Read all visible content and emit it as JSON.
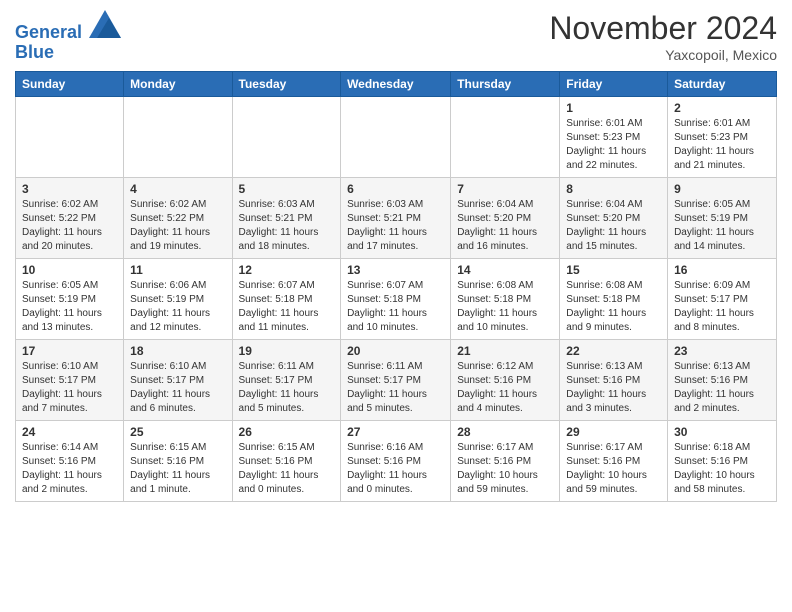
{
  "logo": {
    "line1": "General",
    "line2": "Blue"
  },
  "header": {
    "month": "November 2024",
    "location": "Yaxcopoil, Mexico"
  },
  "weekdays": [
    "Sunday",
    "Monday",
    "Tuesday",
    "Wednesday",
    "Thursday",
    "Friday",
    "Saturday"
  ],
  "weeks": [
    [
      {
        "day": "",
        "info": ""
      },
      {
        "day": "",
        "info": ""
      },
      {
        "day": "",
        "info": ""
      },
      {
        "day": "",
        "info": ""
      },
      {
        "day": "",
        "info": ""
      },
      {
        "day": "1",
        "info": "Sunrise: 6:01 AM\nSunset: 5:23 PM\nDaylight: 11 hours and 22 minutes."
      },
      {
        "day": "2",
        "info": "Sunrise: 6:01 AM\nSunset: 5:23 PM\nDaylight: 11 hours and 21 minutes."
      }
    ],
    [
      {
        "day": "3",
        "info": "Sunrise: 6:02 AM\nSunset: 5:22 PM\nDaylight: 11 hours and 20 minutes."
      },
      {
        "day": "4",
        "info": "Sunrise: 6:02 AM\nSunset: 5:22 PM\nDaylight: 11 hours and 19 minutes."
      },
      {
        "day": "5",
        "info": "Sunrise: 6:03 AM\nSunset: 5:21 PM\nDaylight: 11 hours and 18 minutes."
      },
      {
        "day": "6",
        "info": "Sunrise: 6:03 AM\nSunset: 5:21 PM\nDaylight: 11 hours and 17 minutes."
      },
      {
        "day": "7",
        "info": "Sunrise: 6:04 AM\nSunset: 5:20 PM\nDaylight: 11 hours and 16 minutes."
      },
      {
        "day": "8",
        "info": "Sunrise: 6:04 AM\nSunset: 5:20 PM\nDaylight: 11 hours and 15 minutes."
      },
      {
        "day": "9",
        "info": "Sunrise: 6:05 AM\nSunset: 5:19 PM\nDaylight: 11 hours and 14 minutes."
      }
    ],
    [
      {
        "day": "10",
        "info": "Sunrise: 6:05 AM\nSunset: 5:19 PM\nDaylight: 11 hours and 13 minutes."
      },
      {
        "day": "11",
        "info": "Sunrise: 6:06 AM\nSunset: 5:19 PM\nDaylight: 11 hours and 12 minutes."
      },
      {
        "day": "12",
        "info": "Sunrise: 6:07 AM\nSunset: 5:18 PM\nDaylight: 11 hours and 11 minutes."
      },
      {
        "day": "13",
        "info": "Sunrise: 6:07 AM\nSunset: 5:18 PM\nDaylight: 11 hours and 10 minutes."
      },
      {
        "day": "14",
        "info": "Sunrise: 6:08 AM\nSunset: 5:18 PM\nDaylight: 11 hours and 10 minutes."
      },
      {
        "day": "15",
        "info": "Sunrise: 6:08 AM\nSunset: 5:18 PM\nDaylight: 11 hours and 9 minutes."
      },
      {
        "day": "16",
        "info": "Sunrise: 6:09 AM\nSunset: 5:17 PM\nDaylight: 11 hours and 8 minutes."
      }
    ],
    [
      {
        "day": "17",
        "info": "Sunrise: 6:10 AM\nSunset: 5:17 PM\nDaylight: 11 hours and 7 minutes."
      },
      {
        "day": "18",
        "info": "Sunrise: 6:10 AM\nSunset: 5:17 PM\nDaylight: 11 hours and 6 minutes."
      },
      {
        "day": "19",
        "info": "Sunrise: 6:11 AM\nSunset: 5:17 PM\nDaylight: 11 hours and 5 minutes."
      },
      {
        "day": "20",
        "info": "Sunrise: 6:11 AM\nSunset: 5:17 PM\nDaylight: 11 hours and 5 minutes."
      },
      {
        "day": "21",
        "info": "Sunrise: 6:12 AM\nSunset: 5:16 PM\nDaylight: 11 hours and 4 minutes."
      },
      {
        "day": "22",
        "info": "Sunrise: 6:13 AM\nSunset: 5:16 PM\nDaylight: 11 hours and 3 minutes."
      },
      {
        "day": "23",
        "info": "Sunrise: 6:13 AM\nSunset: 5:16 PM\nDaylight: 11 hours and 2 minutes."
      }
    ],
    [
      {
        "day": "24",
        "info": "Sunrise: 6:14 AM\nSunset: 5:16 PM\nDaylight: 11 hours and 2 minutes."
      },
      {
        "day": "25",
        "info": "Sunrise: 6:15 AM\nSunset: 5:16 PM\nDaylight: 11 hours and 1 minute."
      },
      {
        "day": "26",
        "info": "Sunrise: 6:15 AM\nSunset: 5:16 PM\nDaylight: 11 hours and 0 minutes."
      },
      {
        "day": "27",
        "info": "Sunrise: 6:16 AM\nSunset: 5:16 PM\nDaylight: 11 hours and 0 minutes."
      },
      {
        "day": "28",
        "info": "Sunrise: 6:17 AM\nSunset: 5:16 PM\nDaylight: 10 hours and 59 minutes."
      },
      {
        "day": "29",
        "info": "Sunrise: 6:17 AM\nSunset: 5:16 PM\nDaylight: 10 hours and 59 minutes."
      },
      {
        "day": "30",
        "info": "Sunrise: 6:18 AM\nSunset: 5:16 PM\nDaylight: 10 hours and 58 minutes."
      }
    ]
  ]
}
